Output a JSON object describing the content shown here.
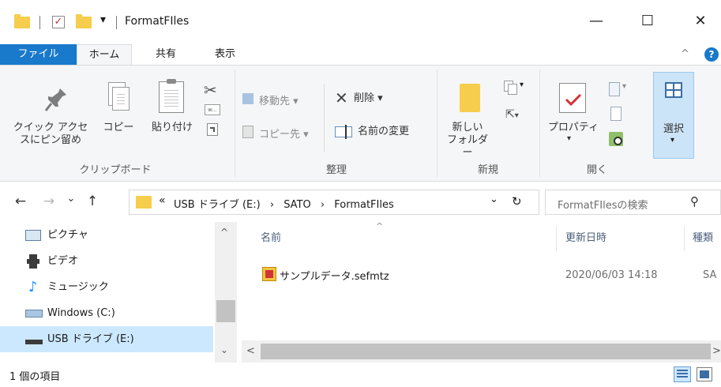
{
  "window": {
    "title": "FormatFIles",
    "minimize_glyph": "—",
    "maximize_glyph": "☐",
    "close_glyph": "✕"
  },
  "qat": {
    "dropdown_glyph": "▾"
  },
  "tabs": {
    "file": "ファイル",
    "home": "ホーム",
    "share": "共有",
    "view": "表示",
    "collapse_glyph": "^",
    "help_glyph": "?"
  },
  "ribbon": {
    "clipboard": {
      "pin_label_line1": "クイック アクセ",
      "pin_label_line2": "スにピン留め",
      "copy_label": "コピー",
      "paste_label": "貼り付け",
      "group_label": "クリップボード"
    },
    "organize": {
      "move_to": "移動先",
      "copy_to": "コピー先",
      "delete": "削除",
      "rename": "名前の変更",
      "group_label": "整理"
    },
    "new": {
      "new_folder_line1": "新しい",
      "new_folder_line2": "フォルダー",
      "group_label": "新規"
    },
    "open": {
      "properties": "プロパティ",
      "group_label": "開く"
    },
    "select": {
      "label": "選択"
    }
  },
  "address": {
    "back_glyph": "←",
    "forward_glyph": "→",
    "recent_glyph": "⌄",
    "up_glyph": "↑",
    "overflow": "«",
    "crumbs": [
      "USB ドライブ (E:)",
      "SATO",
      "FormatFIles"
    ],
    "crumb_sep": "›",
    "dropdown_glyph": "⌄",
    "refresh_glyph": "↻",
    "search_placeholder": "FormatFIlesの検索",
    "search_glyph": "⚲"
  },
  "nav_pane": {
    "items": [
      {
        "label": "ピクチャ",
        "icon": "pictures-icon"
      },
      {
        "label": "ビデオ",
        "icon": "videos-icon"
      },
      {
        "label": "ミュージック",
        "icon": "music-icon"
      },
      {
        "label": "Windows (C:)",
        "icon": "drive-c-icon"
      },
      {
        "label": "USB ドライブ (E:)",
        "icon": "usb-drive-icon"
      }
    ],
    "scroll_up": "^",
    "scroll_down": "⌄"
  },
  "file_list": {
    "columns": [
      "名前",
      "更新日時",
      "種類"
    ],
    "sort_glyph": "^",
    "rows": [
      {
        "name": "サンプルデータ.sefmtz",
        "modified": "2020/06/03 14:18",
        "type": "SA"
      }
    ],
    "scroll_left": "<",
    "scroll_right": ">"
  },
  "status": {
    "item_count": "1 個の項目"
  },
  "colors": {
    "accent": "#1979ca",
    "folder": "#f6cd4c",
    "selection": "#cce8ff"
  }
}
